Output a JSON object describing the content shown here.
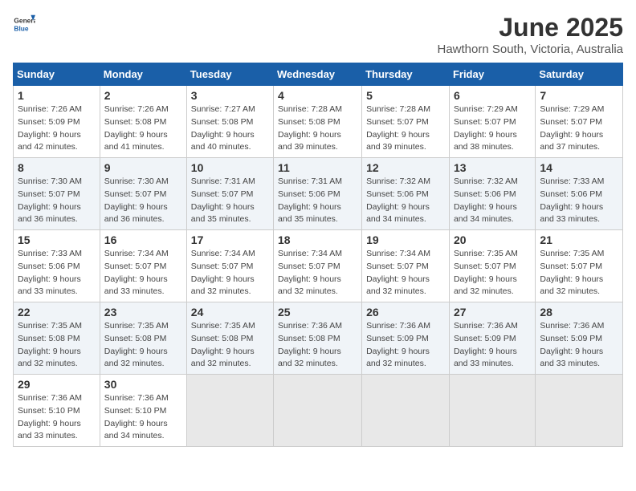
{
  "header": {
    "logo_general": "General",
    "logo_blue": "Blue",
    "month_title": "June 2025",
    "location": "Hawthorn South, Victoria, Australia"
  },
  "calendar": {
    "days_of_week": [
      "Sunday",
      "Monday",
      "Tuesday",
      "Wednesday",
      "Thursday",
      "Friday",
      "Saturday"
    ],
    "weeks": [
      [
        {
          "day": "",
          "empty": true
        },
        {
          "day": "",
          "empty": true
        },
        {
          "day": "",
          "empty": true
        },
        {
          "day": "",
          "empty": true
        },
        {
          "day": "",
          "empty": true
        },
        {
          "day": "",
          "empty": true
        },
        {
          "day": "",
          "empty": true
        }
      ],
      [
        {
          "day": "1",
          "sunrise": "7:26 AM",
          "sunset": "5:09 PM",
          "daylight": "9 hours and 42 minutes."
        },
        {
          "day": "2",
          "sunrise": "7:26 AM",
          "sunset": "5:08 PM",
          "daylight": "9 hours and 41 minutes."
        },
        {
          "day": "3",
          "sunrise": "7:27 AM",
          "sunset": "5:08 PM",
          "daylight": "9 hours and 40 minutes."
        },
        {
          "day": "4",
          "sunrise": "7:28 AM",
          "sunset": "5:08 PM",
          "daylight": "9 hours and 39 minutes."
        },
        {
          "day": "5",
          "sunrise": "7:28 AM",
          "sunset": "5:07 PM",
          "daylight": "9 hours and 39 minutes."
        },
        {
          "day": "6",
          "sunrise": "7:29 AM",
          "sunset": "5:07 PM",
          "daylight": "9 hours and 38 minutes."
        },
        {
          "day": "7",
          "sunrise": "7:29 AM",
          "sunset": "5:07 PM",
          "daylight": "9 hours and 37 minutes."
        }
      ],
      [
        {
          "day": "8",
          "sunrise": "7:30 AM",
          "sunset": "5:07 PM",
          "daylight": "9 hours and 36 minutes."
        },
        {
          "day": "9",
          "sunrise": "7:30 AM",
          "sunset": "5:07 PM",
          "daylight": "9 hours and 36 minutes."
        },
        {
          "day": "10",
          "sunrise": "7:31 AM",
          "sunset": "5:07 PM",
          "daylight": "9 hours and 35 minutes."
        },
        {
          "day": "11",
          "sunrise": "7:31 AM",
          "sunset": "5:06 PM",
          "daylight": "9 hours and 35 minutes."
        },
        {
          "day": "12",
          "sunrise": "7:32 AM",
          "sunset": "5:06 PM",
          "daylight": "9 hours and 34 minutes."
        },
        {
          "day": "13",
          "sunrise": "7:32 AM",
          "sunset": "5:06 PM",
          "daylight": "9 hours and 34 minutes."
        },
        {
          "day": "14",
          "sunrise": "7:33 AM",
          "sunset": "5:06 PM",
          "daylight": "9 hours and 33 minutes."
        }
      ],
      [
        {
          "day": "15",
          "sunrise": "7:33 AM",
          "sunset": "5:06 PM",
          "daylight": "9 hours and 33 minutes."
        },
        {
          "day": "16",
          "sunrise": "7:34 AM",
          "sunset": "5:07 PM",
          "daylight": "9 hours and 33 minutes."
        },
        {
          "day": "17",
          "sunrise": "7:34 AM",
          "sunset": "5:07 PM",
          "daylight": "9 hours and 32 minutes."
        },
        {
          "day": "18",
          "sunrise": "7:34 AM",
          "sunset": "5:07 PM",
          "daylight": "9 hours and 32 minutes."
        },
        {
          "day": "19",
          "sunrise": "7:34 AM",
          "sunset": "5:07 PM",
          "daylight": "9 hours and 32 minutes."
        },
        {
          "day": "20",
          "sunrise": "7:35 AM",
          "sunset": "5:07 PM",
          "daylight": "9 hours and 32 minutes."
        },
        {
          "day": "21",
          "sunrise": "7:35 AM",
          "sunset": "5:07 PM",
          "daylight": "9 hours and 32 minutes."
        }
      ],
      [
        {
          "day": "22",
          "sunrise": "7:35 AM",
          "sunset": "5:08 PM",
          "daylight": "9 hours and 32 minutes."
        },
        {
          "day": "23",
          "sunrise": "7:35 AM",
          "sunset": "5:08 PM",
          "daylight": "9 hours and 32 minutes."
        },
        {
          "day": "24",
          "sunrise": "7:35 AM",
          "sunset": "5:08 PM",
          "daylight": "9 hours and 32 minutes."
        },
        {
          "day": "25",
          "sunrise": "7:36 AM",
          "sunset": "5:08 PM",
          "daylight": "9 hours and 32 minutes."
        },
        {
          "day": "26",
          "sunrise": "7:36 AM",
          "sunset": "5:09 PM",
          "daylight": "9 hours and 32 minutes."
        },
        {
          "day": "27",
          "sunrise": "7:36 AM",
          "sunset": "5:09 PM",
          "daylight": "9 hours and 33 minutes."
        },
        {
          "day": "28",
          "sunrise": "7:36 AM",
          "sunset": "5:09 PM",
          "daylight": "9 hours and 33 minutes."
        }
      ],
      [
        {
          "day": "29",
          "sunrise": "7:36 AM",
          "sunset": "5:10 PM",
          "daylight": "9 hours and 33 minutes."
        },
        {
          "day": "30",
          "sunrise": "7:36 AM",
          "sunset": "5:10 PM",
          "daylight": "9 hours and 34 minutes."
        },
        {
          "day": "",
          "empty": true
        },
        {
          "day": "",
          "empty": true
        },
        {
          "day": "",
          "empty": true
        },
        {
          "day": "",
          "empty": true
        },
        {
          "day": "",
          "empty": true
        }
      ]
    ]
  }
}
